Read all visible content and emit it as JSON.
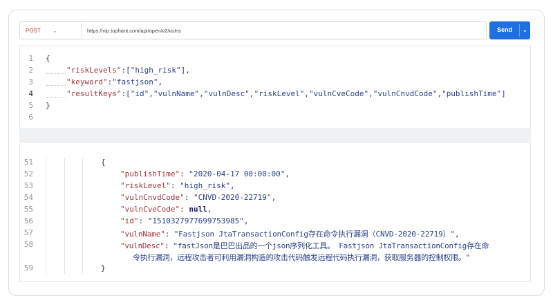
{
  "request": {
    "method": "POST",
    "url": "https://vip.tophant.com/api/open/v2/vulns",
    "send_label": "Send"
  },
  "request_body": {
    "line_numbers": [
      "1",
      "2",
      "3",
      "4",
      "5",
      "6"
    ],
    "open_brace": "{",
    "close_brace": "}",
    "riskLevels_key": "\"riskLevels\"",
    "riskLevels_val": "[\"high_risk\"]",
    "keyword_key": "\"keyword\"",
    "keyword_val": "\"fastjson\"",
    "resultKeys_key": "\"resultKeys\"",
    "resultKeys_val": "[\"id\",\"vulnName\",\"vulnDesc\",\"riskLevel\",\"vulnCveCode\",\"vulnCnvdCode\",\"publishTime\"]"
  },
  "response_body": {
    "line_numbers": [
      "51",
      "52",
      "53",
      "54",
      "55",
      "56",
      "57",
      "58",
      "59"
    ],
    "open_brace": "{",
    "close_brace": "}",
    "fields": [
      {
        "key": "\"publishTime\"",
        "value": "\"2020-04-17 00:00:00\""
      },
      {
        "key": "\"riskLevel\"",
        "value": "\"high_risk\""
      },
      {
        "key": "\"vulnCnvdCode\"",
        "value": "\"CNVD-2020-22719\""
      },
      {
        "key": "\"vulnCveCode\"",
        "value": "null"
      },
      {
        "key": "\"id\"",
        "value": "\"1510327977699753985\""
      },
      {
        "key": "\"vulnName\"",
        "value": "\"Fastjson JtaTransactionConfig存在命令执行漏洞（CNVD-2020-22719）\""
      },
      {
        "key": "\"vulnDesc\"",
        "value": "\"fastJson是巴巴出品的一个json序列化工具。 Fastjson JtaTransactionConfig存在命"
      }
    ],
    "vulnDesc_cont": "令执行漏洞，远程攻击者可利用漏洞构造的攻击代码触发远程代码执行漏洞，获取服务器的控制权限。\""
  },
  "icons": {
    "method_dropdown": "chevron-down-icon",
    "send_dropdown": "chevron-down-icon"
  }
}
